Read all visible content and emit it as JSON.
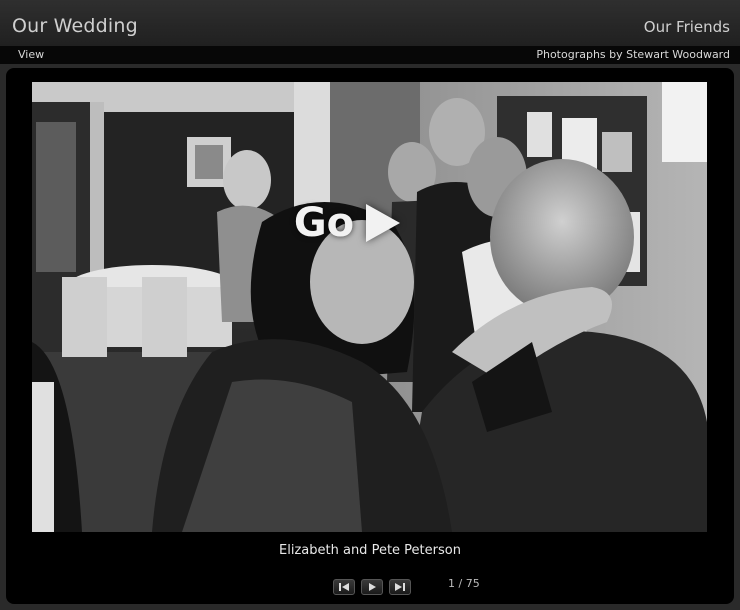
{
  "header": {
    "site_title": "Our Wedding",
    "gallery_title": "Our Friends"
  },
  "subbar": {
    "view_label": "View",
    "credit": "Photographs by Stewart Woodward"
  },
  "slideshow": {
    "go_label": "Go",
    "caption": "Elizabeth and Pete Peterson",
    "counter": "1 / 75",
    "controls": [
      "previous-icon",
      "play-icon",
      "next-icon"
    ]
  },
  "colors": {
    "background": "#2a2a2a",
    "stage": "#000000",
    "text": "#e8e8e8"
  }
}
